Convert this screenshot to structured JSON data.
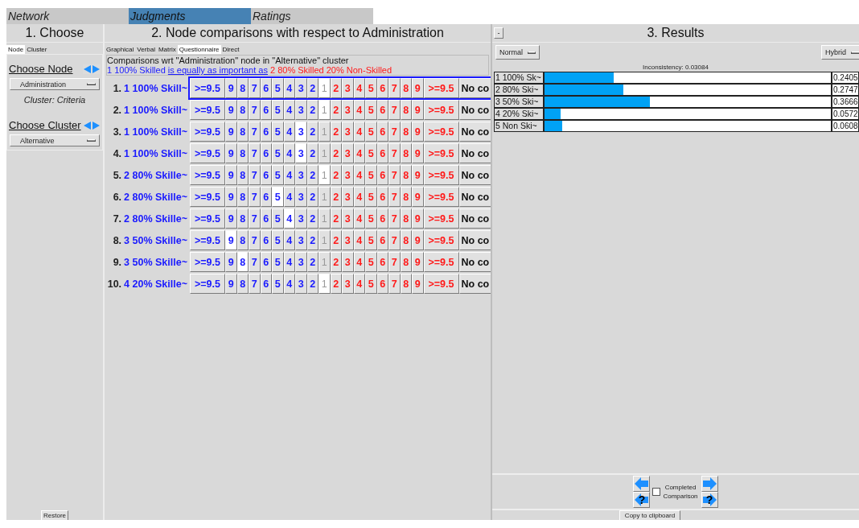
{
  "menu": [
    {
      "label": "Network",
      "selected": false
    },
    {
      "label": "Judgments",
      "selected": true
    },
    {
      "label": "Ratings",
      "selected": false
    }
  ],
  "choose": {
    "title": "1. Choose",
    "tabs": [
      {
        "label": "Node",
        "selected": true
      },
      {
        "label": "Cluster",
        "selected": false
      }
    ],
    "choose_node": "Choose Node",
    "node": "Administration",
    "cluster_note": "Cluster: Criteria",
    "choose_cluster": "Choose Cluster",
    "cluster": "Alternative",
    "restore": "Restore"
  },
  "comparisons": {
    "title": "2. Node comparisons with respect to Administration",
    "tabs": [
      {
        "label": "Graphical",
        "selected": false
      },
      {
        "label": "Verbal",
        "selected": false
      },
      {
        "label": "Matrix",
        "selected": false
      },
      {
        "label": "Questionnaire",
        "selected": true
      },
      {
        "label": "Direct",
        "selected": false
      }
    ],
    "info": "Comparisons wrt \"Administration\" node in \"Alternative\" cluster",
    "left_node": "1 100% Skilled",
    "relation": "is equally as important as",
    "right_node": "2 80% Skilled 20% Non-Skilled",
    "rows": [
      {
        "number": "1.",
        "name": "1 100% Skill~",
        "focused": true,
        "left": [
          {
            "label": ">=9.5",
            "selected": false
          },
          {
            "label": "9",
            "selected": false
          },
          {
            "label": "8",
            "selected": false
          },
          {
            "label": "7",
            "selected": false
          },
          {
            "label": "6",
            "selected": false
          },
          {
            "label": "5",
            "selected": false
          },
          {
            "label": "4",
            "selected": false
          },
          {
            "label": "3",
            "selected": false
          },
          {
            "label": "2",
            "selected": false
          }
        ],
        "equal": {
          "label": "1",
          "selected": true
        },
        "right": [
          {
            "label": "2",
            "selected": false
          },
          {
            "label": "3",
            "selected": false
          },
          {
            "label": "4",
            "selected": false
          },
          {
            "label": "5",
            "selected": false
          },
          {
            "label": "6",
            "selected": false
          },
          {
            "label": "7",
            "selected": false
          },
          {
            "label": "8",
            "selected": false
          },
          {
            "label": "9",
            "selected": false
          },
          {
            "label": ">=9.5",
            "selected": false
          }
        ],
        "no_comparison": "No co"
      },
      {
        "number": "2.",
        "name": "1 100% Skill~",
        "focused": false,
        "left": [
          {
            "label": ">=9.5",
            "selected": false
          },
          {
            "label": "9",
            "selected": false
          },
          {
            "label": "8",
            "selected": false
          },
          {
            "label": "7",
            "selected": false
          },
          {
            "label": "6",
            "selected": false
          },
          {
            "label": "5",
            "selected": false
          },
          {
            "label": "4",
            "selected": false
          },
          {
            "label": "3",
            "selected": false
          },
          {
            "label": "2",
            "selected": false
          }
        ],
        "equal": {
          "label": "1",
          "selected": true
        },
        "right": [
          {
            "label": "2",
            "selected": false
          },
          {
            "label": "3",
            "selected": false
          },
          {
            "label": "4",
            "selected": false
          },
          {
            "label": "5",
            "selected": false
          },
          {
            "label": "6",
            "selected": false
          },
          {
            "label": "7",
            "selected": false
          },
          {
            "label": "8",
            "selected": false
          },
          {
            "label": "9",
            "selected": false
          },
          {
            "label": ">=9.5",
            "selected": false
          }
        ],
        "no_comparison": "No co"
      },
      {
        "number": "3.",
        "name": "1 100% Skill~",
        "focused": false,
        "left": [
          {
            "label": ">=9.5",
            "selected": false
          },
          {
            "label": "9",
            "selected": false
          },
          {
            "label": "8",
            "selected": false
          },
          {
            "label": "7",
            "selected": false
          },
          {
            "label": "6",
            "selected": false
          },
          {
            "label": "5",
            "selected": false
          },
          {
            "label": "4",
            "selected": false
          },
          {
            "label": "3",
            "selected": true
          },
          {
            "label": "2",
            "selected": false
          }
        ],
        "equal": {
          "label": "1",
          "selected": false
        },
        "right": [
          {
            "label": "2",
            "selected": false
          },
          {
            "label": "3",
            "selected": false
          },
          {
            "label": "4",
            "selected": false
          },
          {
            "label": "5",
            "selected": false
          },
          {
            "label": "6",
            "selected": false
          },
          {
            "label": "7",
            "selected": false
          },
          {
            "label": "8",
            "selected": false
          },
          {
            "label": "9",
            "selected": false
          },
          {
            "label": ">=9.5",
            "selected": false
          }
        ],
        "no_comparison": "No co"
      },
      {
        "number": "4.",
        "name": "1 100% Skill~",
        "focused": false,
        "left": [
          {
            "label": ">=9.5",
            "selected": false
          },
          {
            "label": "9",
            "selected": false
          },
          {
            "label": "8",
            "selected": false
          },
          {
            "label": "7",
            "selected": false
          },
          {
            "label": "6",
            "selected": false
          },
          {
            "label": "5",
            "selected": false
          },
          {
            "label": "4",
            "selected": false
          },
          {
            "label": "3",
            "selected": true
          },
          {
            "label": "2",
            "selected": false
          }
        ],
        "equal": {
          "label": "1",
          "selected": false
        },
        "right": [
          {
            "label": "2",
            "selected": false
          },
          {
            "label": "3",
            "selected": false
          },
          {
            "label": "4",
            "selected": false
          },
          {
            "label": "5",
            "selected": false
          },
          {
            "label": "6",
            "selected": false
          },
          {
            "label": "7",
            "selected": false
          },
          {
            "label": "8",
            "selected": false
          },
          {
            "label": "9",
            "selected": false
          },
          {
            "label": ">=9.5",
            "selected": false
          }
        ],
        "no_comparison": "No co"
      },
      {
        "number": "5.",
        "name": "2 80% Skille~",
        "focused": false,
        "left": [
          {
            "label": ">=9.5",
            "selected": false
          },
          {
            "label": "9",
            "selected": false
          },
          {
            "label": "8",
            "selected": false
          },
          {
            "label": "7",
            "selected": false
          },
          {
            "label": "6",
            "selected": false
          },
          {
            "label": "5",
            "selected": false
          },
          {
            "label": "4",
            "selected": false
          },
          {
            "label": "3",
            "selected": false
          },
          {
            "label": "2",
            "selected": false
          }
        ],
        "equal": {
          "label": "1",
          "selected": true
        },
        "right": [
          {
            "label": "2",
            "selected": false
          },
          {
            "label": "3",
            "selected": false
          },
          {
            "label": "4",
            "selected": false
          },
          {
            "label": "5",
            "selected": false
          },
          {
            "label": "6",
            "selected": false
          },
          {
            "label": "7",
            "selected": false
          },
          {
            "label": "8",
            "selected": false
          },
          {
            "label": "9",
            "selected": false
          },
          {
            "label": ">=9.5",
            "selected": false
          }
        ],
        "no_comparison": "No co"
      },
      {
        "number": "6.",
        "name": "2 80% Skille~",
        "focused": false,
        "left": [
          {
            "label": ">=9.5",
            "selected": false
          },
          {
            "label": "9",
            "selected": false
          },
          {
            "label": "8",
            "selected": false
          },
          {
            "label": "7",
            "selected": false
          },
          {
            "label": "6",
            "selected": false
          },
          {
            "label": "5",
            "selected": true
          },
          {
            "label": "4",
            "selected": false
          },
          {
            "label": "3",
            "selected": false
          },
          {
            "label": "2",
            "selected": false
          }
        ],
        "equal": {
          "label": "1",
          "selected": false
        },
        "right": [
          {
            "label": "2",
            "selected": false
          },
          {
            "label": "3",
            "selected": false
          },
          {
            "label": "4",
            "selected": false
          },
          {
            "label": "5",
            "selected": false
          },
          {
            "label": "6",
            "selected": false
          },
          {
            "label": "7",
            "selected": false
          },
          {
            "label": "8",
            "selected": false
          },
          {
            "label": "9",
            "selected": false
          },
          {
            "label": ">=9.5",
            "selected": false
          }
        ],
        "no_comparison": "No co"
      },
      {
        "number": "7.",
        "name": "2 80% Skille~",
        "focused": false,
        "left": [
          {
            "label": ">=9.5",
            "selected": false
          },
          {
            "label": "9",
            "selected": false
          },
          {
            "label": "8",
            "selected": false
          },
          {
            "label": "7",
            "selected": false
          },
          {
            "label": "6",
            "selected": false
          },
          {
            "label": "5",
            "selected": false
          },
          {
            "label": "4",
            "selected": true
          },
          {
            "label": "3",
            "selected": false
          },
          {
            "label": "2",
            "selected": false
          }
        ],
        "equal": {
          "label": "1",
          "selected": false
        },
        "right": [
          {
            "label": "2",
            "selected": false
          },
          {
            "label": "3",
            "selected": false
          },
          {
            "label": "4",
            "selected": false
          },
          {
            "label": "5",
            "selected": false
          },
          {
            "label": "6",
            "selected": false
          },
          {
            "label": "7",
            "selected": false
          },
          {
            "label": "8",
            "selected": false
          },
          {
            "label": "9",
            "selected": false
          },
          {
            "label": ">=9.5",
            "selected": false
          }
        ],
        "no_comparison": "No co"
      },
      {
        "number": "8.",
        "name": "3 50% Skille~",
        "focused": false,
        "left": [
          {
            "label": ">=9.5",
            "selected": false
          },
          {
            "label": "9",
            "selected": true
          },
          {
            "label": "8",
            "selected": false
          },
          {
            "label": "7",
            "selected": false
          },
          {
            "label": "6",
            "selected": false
          },
          {
            "label": "5",
            "selected": false
          },
          {
            "label": "4",
            "selected": false
          },
          {
            "label": "3",
            "selected": false
          },
          {
            "label": "2",
            "selected": false
          }
        ],
        "equal": {
          "label": "1",
          "selected": false
        },
        "right": [
          {
            "label": "2",
            "selected": false
          },
          {
            "label": "3",
            "selected": false
          },
          {
            "label": "4",
            "selected": false
          },
          {
            "label": "5",
            "selected": false
          },
          {
            "label": "6",
            "selected": false
          },
          {
            "label": "7",
            "selected": false
          },
          {
            "label": "8",
            "selected": false
          },
          {
            "label": "9",
            "selected": false
          },
          {
            "label": ">=9.5",
            "selected": false
          }
        ],
        "no_comparison": "No co"
      },
      {
        "number": "9.",
        "name": "3 50% Skille~",
        "focused": false,
        "left": [
          {
            "label": ">=9.5",
            "selected": false
          },
          {
            "label": "9",
            "selected": false
          },
          {
            "label": "8",
            "selected": true
          },
          {
            "label": "7",
            "selected": false
          },
          {
            "label": "6",
            "selected": false
          },
          {
            "label": "5",
            "selected": false
          },
          {
            "label": "4",
            "selected": false
          },
          {
            "label": "3",
            "selected": false
          },
          {
            "label": "2",
            "selected": false
          }
        ],
        "equal": {
          "label": "1",
          "selected": false
        },
        "right": [
          {
            "label": "2",
            "selected": false
          },
          {
            "label": "3",
            "selected": false
          },
          {
            "label": "4",
            "selected": false
          },
          {
            "label": "5",
            "selected": false
          },
          {
            "label": "6",
            "selected": false
          },
          {
            "label": "7",
            "selected": false
          },
          {
            "label": "8",
            "selected": false
          },
          {
            "label": "9",
            "selected": false
          },
          {
            "label": ">=9.5",
            "selected": false
          }
        ],
        "no_comparison": "No co"
      },
      {
        "number": "10.",
        "name": "4 20% Skille~",
        "focused": false,
        "left": [
          {
            "label": ">=9.5",
            "selected": false
          },
          {
            "label": "9",
            "selected": false
          },
          {
            "label": "8",
            "selected": false
          },
          {
            "label": "7",
            "selected": false
          },
          {
            "label": "6",
            "selected": false
          },
          {
            "label": "5",
            "selected": false
          },
          {
            "label": "4",
            "selected": false
          },
          {
            "label": "3",
            "selected": false
          },
          {
            "label": "2",
            "selected": false
          }
        ],
        "equal": {
          "label": "1",
          "selected": true
        },
        "right": [
          {
            "label": "2",
            "selected": false
          },
          {
            "label": "3",
            "selected": false
          },
          {
            "label": "4",
            "selected": false
          },
          {
            "label": "5",
            "selected": false
          },
          {
            "label": "6",
            "selected": false
          },
          {
            "label": "7",
            "selected": false
          },
          {
            "label": "8",
            "selected": false
          },
          {
            "label": "9",
            "selected": false
          },
          {
            "label": ">=9.5",
            "selected": false
          }
        ],
        "no_comparison": "No co"
      }
    ]
  },
  "results": {
    "collapse": "-",
    "title": "3. Results",
    "mode": "Normal",
    "method": "Hybrid",
    "inconsistency": "Inconsistency: 0.03084",
    "items": [
      {
        "name": "1 100% Sk~",
        "level": 0.2405,
        "value": "0.2405"
      },
      {
        "name": "2 80% Ski~",
        "level": 0.2747,
        "value": "0.2747"
      },
      {
        "name": "3 50% Ski~",
        "level": 0.3666,
        "value": "0.3666"
      },
      {
        "name": "4 20% Ski~",
        "level": 0.0572,
        "value": "0.0572"
      },
      {
        "name": "5 Non Ski~",
        "level": 0.0608,
        "value": "0.0608"
      }
    ],
    "completed": {
      "label_1": "Completed",
      "label_2": "Comparison",
      "checked": false
    },
    "help": "?",
    "copy": "Copy to clipboard"
  }
}
